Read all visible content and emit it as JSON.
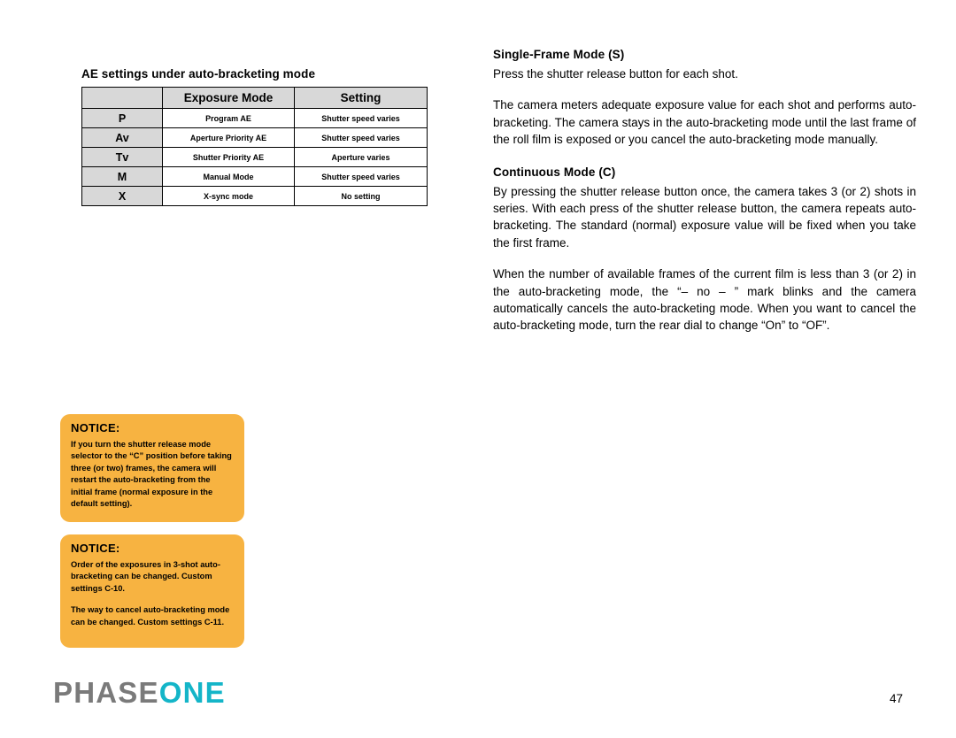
{
  "table": {
    "caption": "AE settings under auto-bracketing mode",
    "headers": [
      "",
      "Exposure Mode",
      "Setting"
    ],
    "rows": [
      {
        "mode": "P",
        "exposure": "Program AE",
        "setting": "Shutter speed varies"
      },
      {
        "mode": "Av",
        "exposure": "Aperture Priority AE",
        "setting": "Shutter speed varies"
      },
      {
        "mode": "Tv",
        "exposure": "Shutter Priority AE",
        "setting": "Aperture varies"
      },
      {
        "mode": "M",
        "exposure": "Manual Mode",
        "setting": "Shutter speed varies"
      },
      {
        "mode": "X",
        "exposure": "X-sync mode",
        "setting": "No setting"
      }
    ]
  },
  "notices": [
    {
      "title": "NOTICE:",
      "paragraphs": [
        "If you turn the shutter release mode selector to the “C” position before taking three (or two) frames, the camera will restart the auto-bracketing from the initial frame (normal exposure in the default setting)."
      ]
    },
    {
      "title": "NOTICE:",
      "paragraphs": [
        "Order of the exposures in 3-shot auto-bracketing can be changed. Custom settings C-10.",
        "The way to cancel auto-bracketing mode can be changed. Custom settings C-11."
      ]
    }
  ],
  "right": {
    "section1": {
      "heading": "Single-Frame Mode (S)",
      "para1": "Press the shutter release button for each shot.",
      "para2": "The camera meters adequate exposure value for each shot and performs auto-bracketing. The camera stays in the auto-bracketing mode until the last frame of the roll film is exposed or you cancel the auto-bracketing mode manually."
    },
    "section2": {
      "heading": "Continuous Mode (C)",
      "para1": "By pressing the shutter release button once, the camera takes 3 (or 2) shots in series. With each press of the shutter release button, the camera repeats auto-bracketing. The standard (normal) exposure value will be fixed when you take the first frame.",
      "para2": "When the number of available frames of the current film is less than 3 (or 2) in the auto-bracketing mode, the “– no – ” mark blinks and the camera automatically cancels the auto-bracketing mode. When you want to cancel the auto-bracketing mode, turn the rear dial to change “On” to “OF”."
    }
  },
  "footer": {
    "logo_part1": "PHASE",
    "logo_part2": "ONE",
    "page_number": "47"
  },
  "colors": {
    "notice_bg": "#f7b341",
    "table_header_bg": "#d8d8d8",
    "logo_grey": "#7a7a7a",
    "logo_cyan": "#14b5c8"
  }
}
